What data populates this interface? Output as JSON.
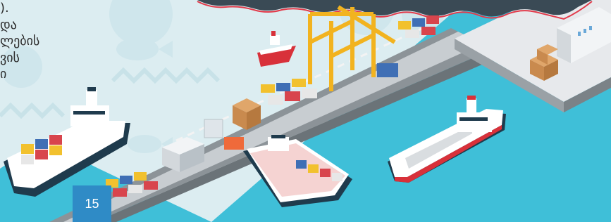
{
  "text_fragment": {
    "lines": [
      ").",
      "და",
      "ლების",
      "ვის",
      "ი"
    ]
  },
  "page": {
    "number": "15",
    "accent_color": "#2f8bc6",
    "sea_color": "#3dc0d8",
    "background_color": "#ddeef2"
  },
  "illustration": {
    "subject": "port-scene",
    "items": [
      "cargo-ships",
      "cargo-crane",
      "container-stacks",
      "pier",
      "warehouse",
      "tugboat"
    ]
  }
}
